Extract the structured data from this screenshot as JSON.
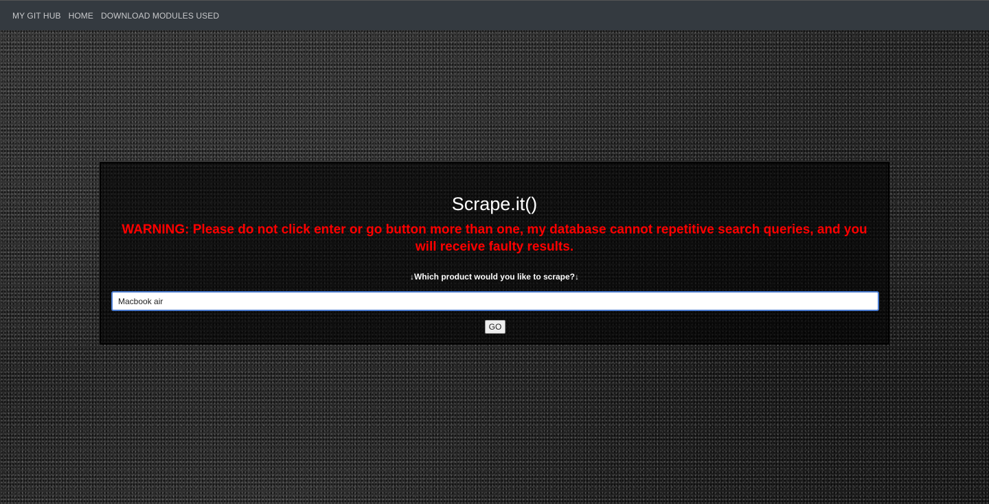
{
  "nav": {
    "items": [
      {
        "label": "MY GIT HUB"
      },
      {
        "label": "HOME"
      },
      {
        "label": "DOWNLOAD MODULES USED"
      }
    ]
  },
  "panel": {
    "title": "Scrape.it()",
    "warning": "WARNING: Please do not click enter or go button more than one, my database cannot repetitive search queries, and you will receive faulty results.",
    "prompt": "↓Which product would you like to scrape?↓",
    "search_value": "Macbook air",
    "go_label": "GO"
  },
  "colors": {
    "navbar": "#343a40",
    "warning": "#ff0000",
    "input_border": "#4a7bd0"
  }
}
